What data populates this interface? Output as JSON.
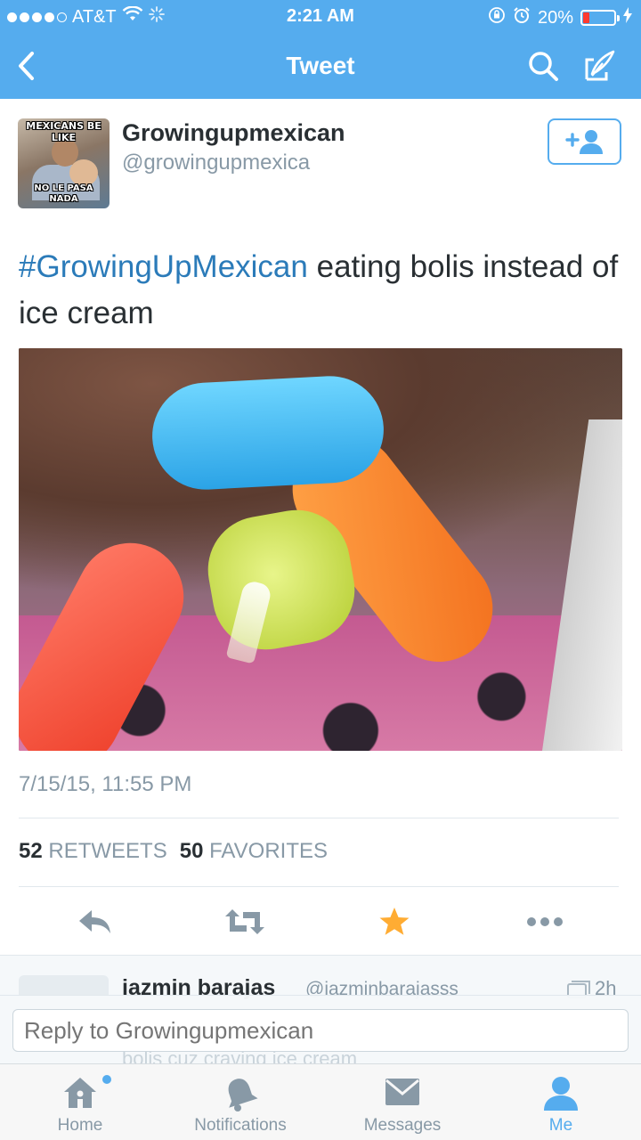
{
  "status": {
    "carrier": "AT&T",
    "time": "2:21 AM",
    "battery": "20%",
    "battery_level": 0.2
  },
  "nav": {
    "title": "Tweet"
  },
  "tweet": {
    "avatar_top_text": "MEXICANS BE LIKE",
    "avatar_bottom_text": "NO LE PASA NADA",
    "display_name": "Growingupmexican",
    "screen_name": "@growingupmexica",
    "hashtag": "#GrowingUpMexican",
    "text_rest": " eating bolis instead of ice cream",
    "timestamp": "7/15/15, 11:55 PM",
    "retweets_count": "52",
    "retweets_label": "RETWEETS",
    "favorites_count": "50",
    "favorites_label": "FAVORITES"
  },
  "reply_preview": {
    "name": "iazmin barajas",
    "handle": "@iazminbarajasss",
    "time": "2h",
    "text": "bolis cuz craving ice cream"
  },
  "reply_bar": {
    "placeholder": "Reply to Growingupmexican"
  },
  "tabs": [
    {
      "label": "Home",
      "icon": "home-icon"
    },
    {
      "label": "Notifications",
      "icon": "bell-icon"
    },
    {
      "label": "Messages",
      "icon": "envelope-icon"
    },
    {
      "label": "Me",
      "icon": "person-icon"
    }
  ],
  "colors": {
    "brand": "#55acee",
    "hashtag": "#2b7bb9",
    "favorite": "#ffac33",
    "muted": "#8899a6"
  }
}
